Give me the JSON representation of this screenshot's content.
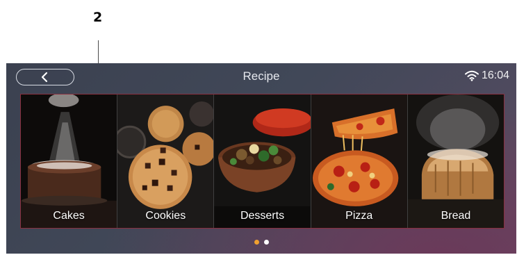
{
  "annotation": {
    "number": "2"
  },
  "header": {
    "title": "Recipe",
    "back_icon": "chevron-left-icon"
  },
  "status_bar": {
    "wifi_icon": "wifi-icon",
    "time": "16:04"
  },
  "categories": [
    {
      "label": "Cakes"
    },
    {
      "label": "Cookies"
    },
    {
      "label": "Desserts"
    },
    {
      "label": "Pizza"
    },
    {
      "label": "Bread"
    }
  ],
  "pagination": {
    "page_count": 2,
    "current_page": 1
  },
  "colors": {
    "active_dot": "#f0a030",
    "inactive_dot": "#ffffff",
    "grid_border": "#8a3040"
  }
}
